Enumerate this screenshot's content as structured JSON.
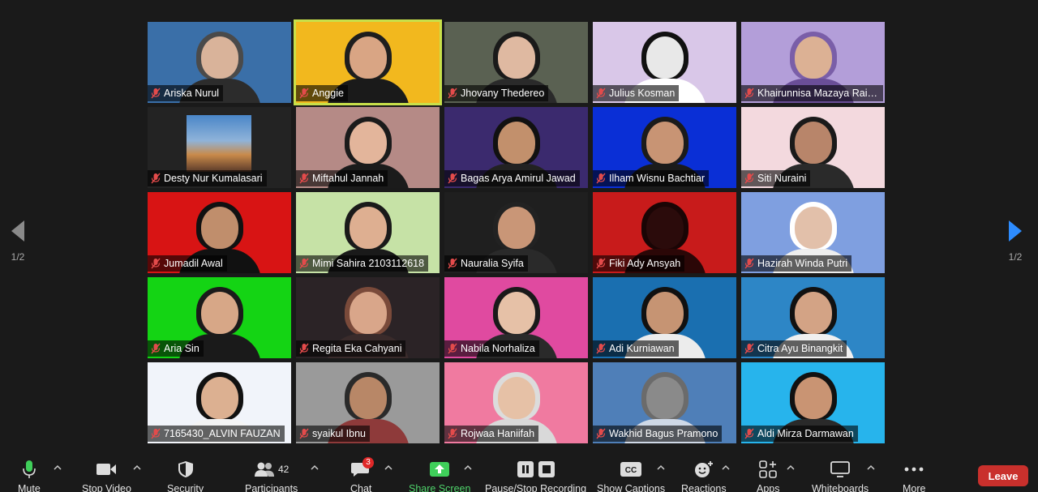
{
  "pagination": {
    "current": "1/2"
  },
  "participants_count": "42",
  "chat_badge": "3",
  "tiles": [
    {
      "name": "Ariska Nurul",
      "bg": "#3a6fa8",
      "skin": "#d9b39a",
      "hair": "#3a3a3a",
      "shirt": "#2c2c2c",
      "hijab": "#4a4a4a"
    },
    {
      "name": "Anggie",
      "bg": "#f2b81e",
      "skin": "#d9a584",
      "hair": "#1e1e1e",
      "shirt": "#1a1a1a",
      "active": true
    },
    {
      "name": "Jhovany Thedereo",
      "bg": "#5a6152",
      "skin": "#dfb9a1",
      "hair": "#1a1a1a",
      "shirt": "#2a2a2a"
    },
    {
      "name": "Julius Kosman",
      "bg": "#d9c7e8",
      "skin": "#e8e8e8",
      "hair": "#111111",
      "shirt": "#ffffff"
    },
    {
      "name": "Khairunnisa Mazaya Raih...",
      "bg": "#b39ed9",
      "skin": "#dcb194",
      "hair": "#7a5ea8",
      "shirt": "#6a4e98"
    },
    {
      "name": "Desty Nur Kumalasari",
      "bg": "#232323",
      "skin": "#d6a37a",
      "hair": "#5b3f2a",
      "shirt": "#2a2a2a",
      "photo": true
    },
    {
      "name": "Miftahul Jannah",
      "bg": "#b58a86",
      "skin": "#e3b59b",
      "hair": "#1b1b1b",
      "shirt": "#1b1b1b"
    },
    {
      "name": "Bagas Arya Amirul Jawad",
      "bg": "#3b2a6e",
      "skin": "#c2906c",
      "hair": "#111111",
      "shirt": "#222222"
    },
    {
      "name": "Ilham Wisnu Bachtiar",
      "bg": "#0a2fd6",
      "skin": "#c89474",
      "hair": "#1b1b1b",
      "shirt": "#1b1b1b"
    },
    {
      "name": "Siti Nuraini",
      "bg": "#f3d9de",
      "skin": "#b8856a",
      "hair": "#1a1a1a",
      "shirt": "#2a2a2a"
    },
    {
      "name": "Jumadil Awal",
      "bg": "#d81414",
      "skin": "#c08e6c",
      "hair": "#111111",
      "shirt": "#111111"
    },
    {
      "name": "Mimi Sahira 2103112618",
      "bg": "#c6e2a6",
      "skin": "#deaf91",
      "hair": "#1a1a1a",
      "shirt": "#1a1a1a"
    },
    {
      "name": "Nauralia Syifa",
      "bg": "#1f1f1f",
      "skin": "#c99677",
      "hair": "#222222",
      "shirt": "#2a2a2a"
    },
    {
      "name": "Fiki Ady Ansyah",
      "bg": "#c81b1b",
      "skin": "#2b0b0b",
      "hair": "#1a0505",
      "shirt": "#2b0707"
    },
    {
      "name": "Hazirah Winda Putri",
      "bg": "#7f9fe0",
      "skin": "#e2c0aa",
      "hair": "#ffffff",
      "shirt": "#eeeeee"
    },
    {
      "name": "Aria Sin",
      "bg": "#14d414",
      "skin": "#d7a787",
      "hair": "#1a1a1a",
      "shirt": "#1a1a1a"
    },
    {
      "name": "Regita Eka Cahyani",
      "bg": "#2b2326",
      "skin": "#d9a68a",
      "hair": "#7a4a3a",
      "shirt": "#3a2b2b"
    },
    {
      "name": "Nabila Norhaliza",
      "bg": "#e04aa0",
      "skin": "#e6c1a7",
      "hair": "#1a1a1a",
      "shirt": "#2a2a2a"
    },
    {
      "name": "Adi Kurniawan",
      "bg": "#1a6fb0",
      "skin": "#c69473",
      "hair": "#111111",
      "shirt": "#ececec"
    },
    {
      "name": "Citra Ayu Binangkit",
      "bg": "#2d86c6",
      "skin": "#d3a385",
      "hair": "#111111",
      "shirt": "#f0f0f0"
    },
    {
      "name": "7165430_ALVIN FAUZAN",
      "bg": "#f1f4fa",
      "skin": "#dcb091",
      "hair": "#111111",
      "shirt": "#f4f4f4"
    },
    {
      "name": "syaikul Ibnu",
      "bg": "#9a9a9a",
      "skin": "#b88767",
      "hair": "#2a2a2a",
      "shirt": "#8e3a3a"
    },
    {
      "name": "Rojwaa Haniifah",
      "bg": "#f07aa0",
      "skin": "#e6c1a6",
      "hair": "#dcdcdc",
      "shirt": "#d9d9d9"
    },
    {
      "name": "Wakhid Bagus Pramono",
      "bg": "#4f7fb8",
      "skin": "#8a8a8a",
      "hair": "#6b6b6b",
      "shirt": "#cfd8e6"
    },
    {
      "name": "Aldi Mirza Darmawan",
      "bg": "#27b4ec",
      "skin": "#c99473",
      "hair": "#111111",
      "shirt": "#2a2a2a"
    }
  ],
  "toolbar": {
    "mute": "Mute",
    "stop_video": "Stop Video",
    "security": "Security",
    "participants": "Participants",
    "chat": "Chat",
    "share_screen": "Share Screen",
    "recording": "Pause/Stop Recording",
    "captions": "Show Captions",
    "reactions": "Reactions",
    "apps": "Apps",
    "whiteboards": "Whiteboards",
    "more": "More",
    "leave": "Leave",
    "cc_text": "CC"
  }
}
